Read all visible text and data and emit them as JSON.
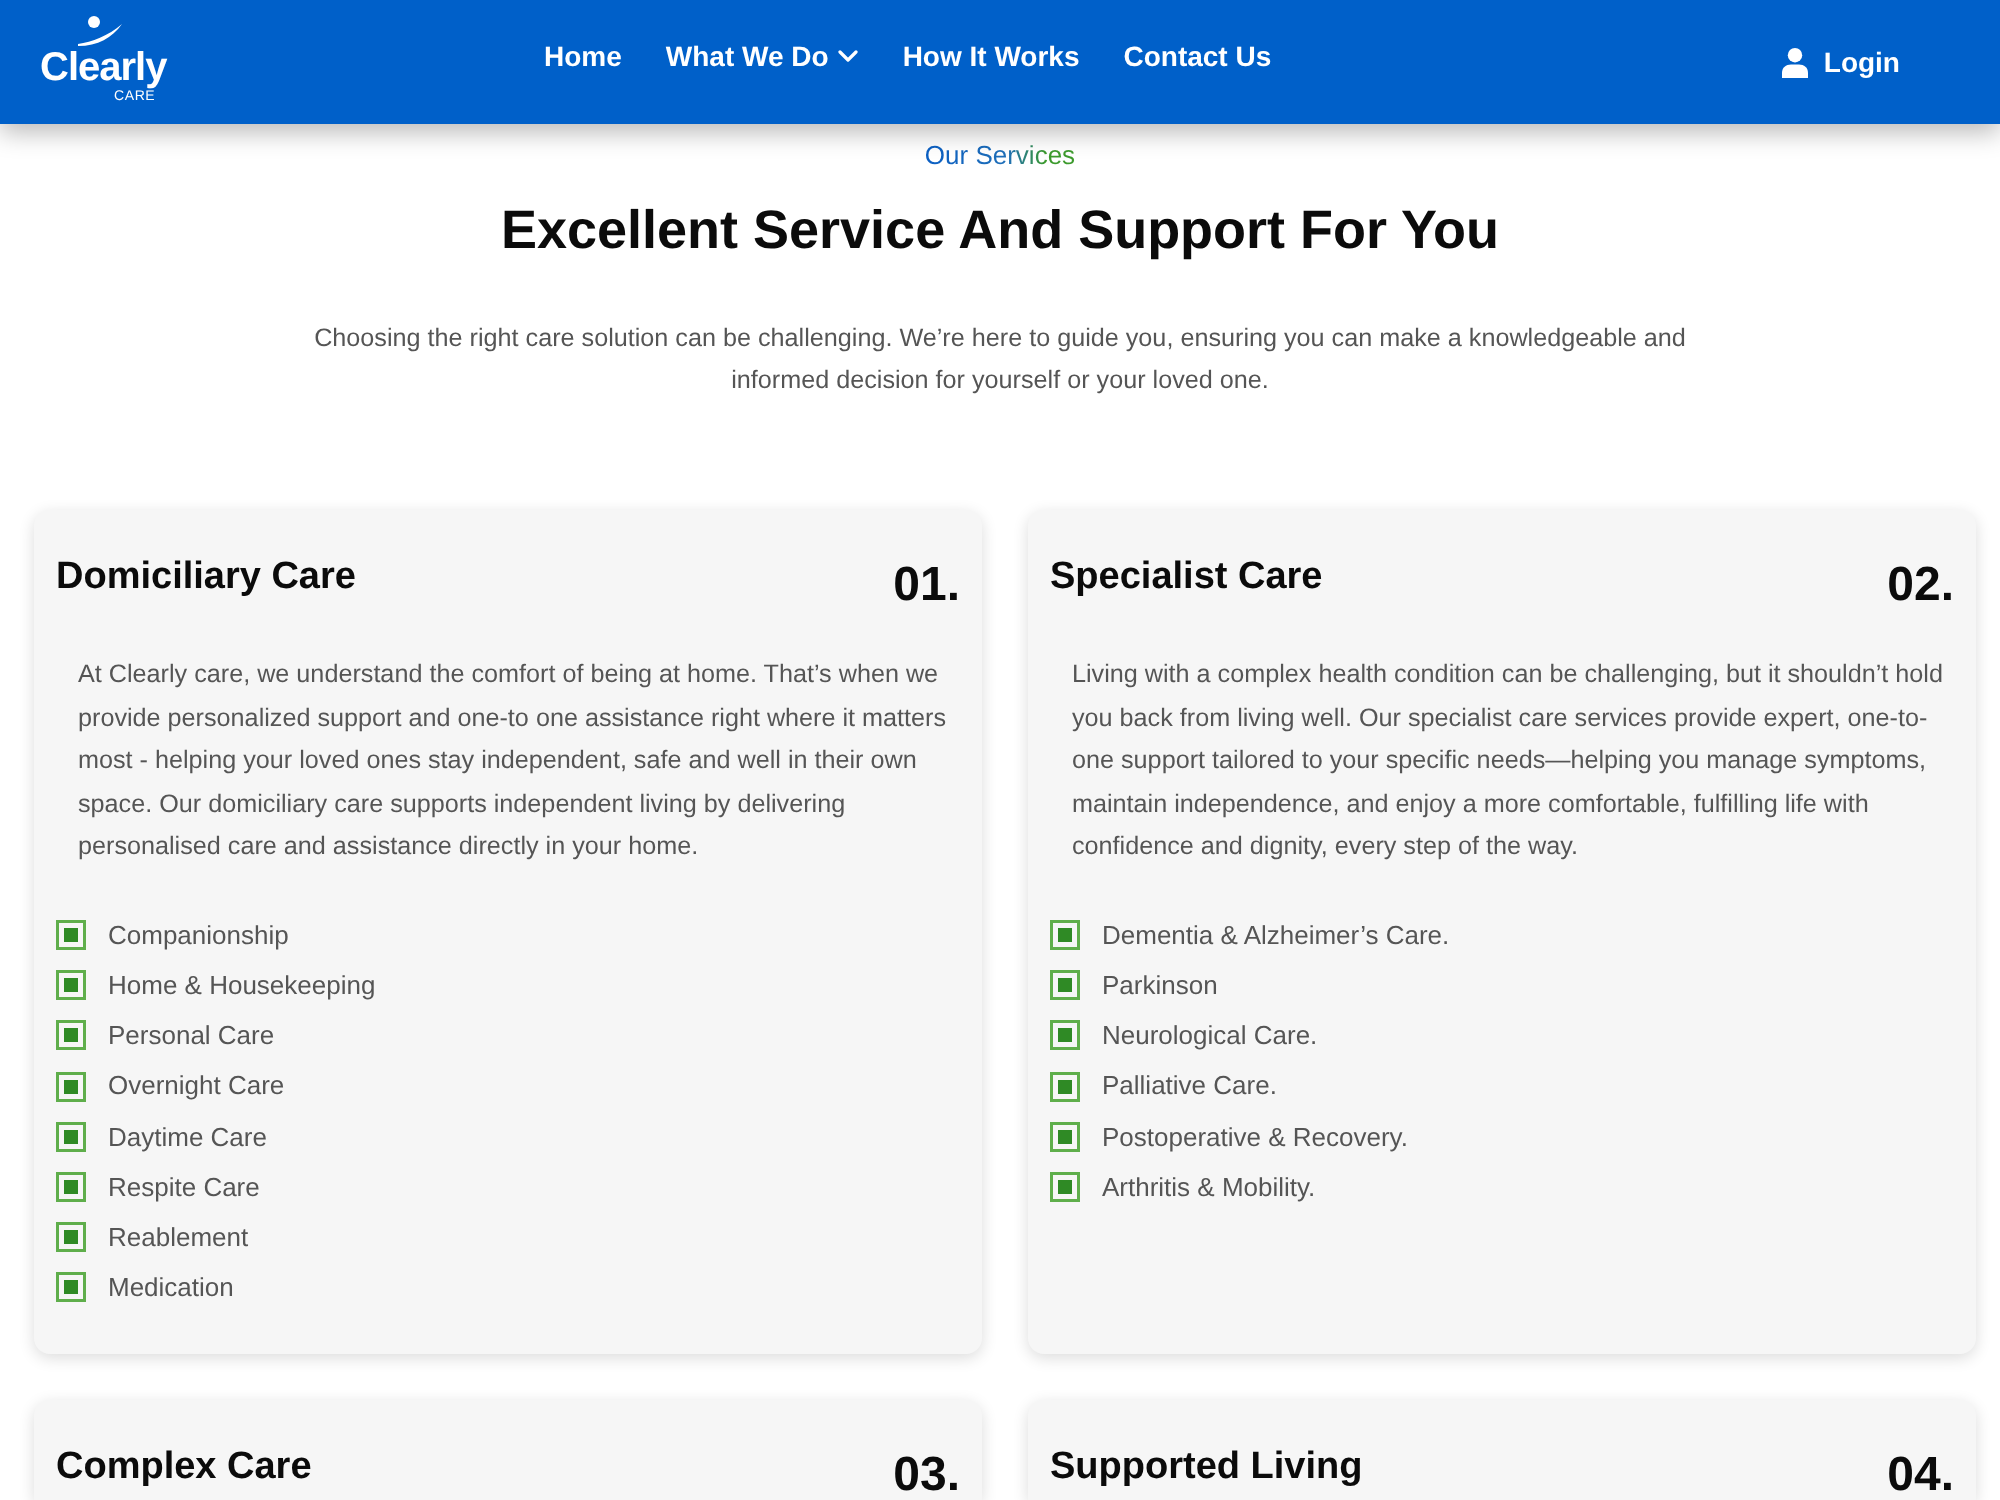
{
  "header": {
    "logo": {
      "name": "Clearly",
      "tagline": "CARE"
    },
    "nav": [
      {
        "label": "Home",
        "dropdown": false
      },
      {
        "label": "What We Do",
        "dropdown": true
      },
      {
        "label": "How It Works",
        "dropdown": false
      },
      {
        "label": "Contact Us",
        "dropdown": false
      }
    ],
    "login": "Login"
  },
  "intro": {
    "eyebrow": "Our Services",
    "title": "Excellent Service And Support For You",
    "text": "Choosing the right care solution can be challenging. We’re here to guide you, ensuring you can make a knowledgeable and informed decision for yourself or your loved one."
  },
  "services": [
    {
      "title": "Domiciliary Care",
      "number": "01.",
      "text": "At Clearly care, we understand the comfort of being at home. That’s when we provide personalized support and one-to one assistance right where it matters most - helping your loved ones stay independent, safe and well in their own space. Our domiciliary care supports independent living by delivering personalised care and assistance directly in your home.",
      "items": [
        "Companionship",
        "Home & Housekeeping",
        "Personal Care",
        "Overnight Care",
        "Daytime Care",
        "Respite Care",
        "Reablement",
        "Medication"
      ]
    },
    {
      "title": "Specialist Care",
      "number": "02.",
      "text": "Living with a complex health condition can be challenging, but it shouldn’t hold you back from living well. Our specialist care services provide expert, one-to-one support tailored to your specific needs—helping you manage symptoms, maintain independence, and enjoy a more comfortable, fulfilling life with confidence and dignity, every step of the way.",
      "items": [
        "Dementia & Alzheimer’s Care.",
        "Parkinson",
        "Neurological Care.",
        "Palliative Care.",
        "Postoperative & Recovery.",
        "Arthritis & Mobility."
      ]
    },
    {
      "title": "Complex Care",
      "number": "03."
    },
    {
      "title": "Supported Living",
      "number": "04."
    }
  ]
}
